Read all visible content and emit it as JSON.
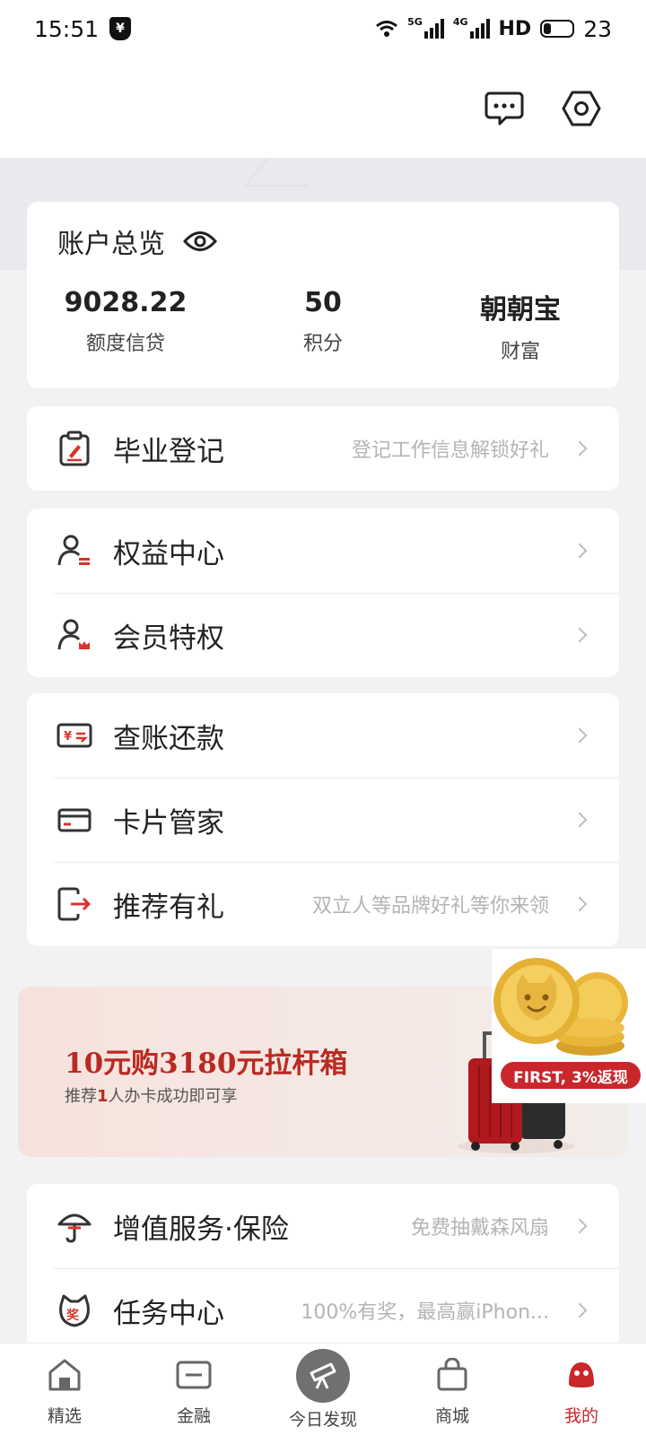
{
  "status_bar": {
    "time": "15:51",
    "shield_glyph": "¥",
    "network_1": "5G",
    "network_2": "4G",
    "hd": "HD",
    "battery": "23"
  },
  "header": {
    "icons": [
      "message-icon",
      "settings-icon"
    ]
  },
  "account": {
    "title": "账户总览",
    "stats": [
      {
        "value": "9028.22",
        "label": "额度信贷"
      },
      {
        "value": "50",
        "label": "积分"
      },
      {
        "value": "朝朝宝",
        "label": "财富"
      }
    ]
  },
  "graduation": {
    "label": "毕业登记",
    "hint": "登记工作信息解锁好礼"
  },
  "group_rights": [
    {
      "label": "权益中心",
      "hint": ""
    },
    {
      "label": "会员特权",
      "hint": ""
    }
  ],
  "group_cards": [
    {
      "label": "查账还款",
      "hint": ""
    },
    {
      "label": "卡片管家",
      "hint": ""
    },
    {
      "label": "推荐有礼",
      "hint": "双立人等品牌好礼等你来领"
    }
  ],
  "banner": {
    "title": "10元购3180元拉杆箱",
    "sub_prefix": "推荐",
    "sub_number": "1",
    "sub_suffix": "人办卡成功即可享"
  },
  "floating_promo": {
    "text": "FIRST, 3%返现"
  },
  "group_services": [
    {
      "label": "增值服务·保险",
      "hint": "免费抽戴森风扇"
    },
    {
      "label": "任务中心",
      "hint": "100%有奖，最高赢iPhon..."
    }
  ],
  "bottom_nav": [
    {
      "label": "精选",
      "active": false
    },
    {
      "label": "金融",
      "active": false
    },
    {
      "label": "今日发现",
      "active": false
    },
    {
      "label": "商城",
      "active": false
    },
    {
      "label": "我的",
      "active": true
    }
  ],
  "colors": {
    "accent": "#c9272c",
    "background": "#f2f2f4"
  }
}
